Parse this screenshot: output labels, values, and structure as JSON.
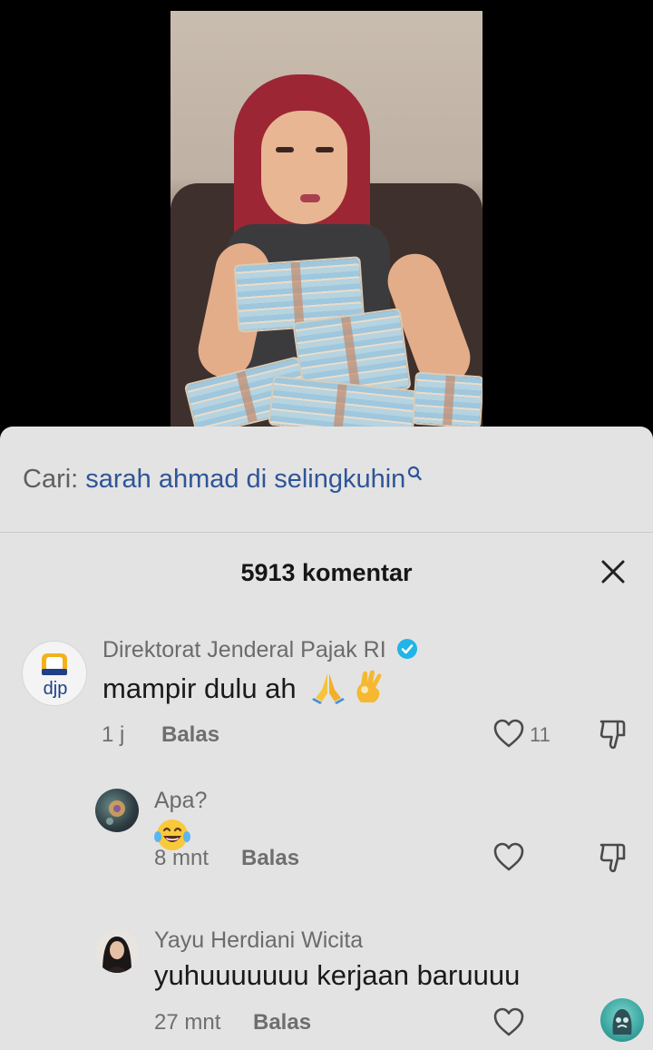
{
  "search": {
    "prefix": "Cari:",
    "query": "sarah ahmad di selingkuhin"
  },
  "comments_header": {
    "count_label": "5913 komentar"
  },
  "comments": [
    {
      "author": "Direktorat Jenderal Pajak RI",
      "verified": true,
      "avatar_text": "djp",
      "text": "mampir dulu ah",
      "emojis": [
        "folded-hands",
        "ok-hand"
      ],
      "time": "1 j",
      "reply_label": "Balas",
      "likes": "11"
    },
    {
      "author": "Apa?",
      "text_emoji": "face-with-tears-of-joy",
      "time": "8 mnt",
      "reply_label": "Balas"
    },
    {
      "author": "Yayu Herdiani Wicita",
      "text": "yuhuuuuuuu kerjaan baruuuu",
      "time": "27 mnt",
      "reply_label": "Balas"
    }
  ],
  "colors": {
    "sheet_bg": "#e3e3e3",
    "search_link": "#2e5597",
    "verified": "#20b5e6",
    "djp_blue": "#1f3f86",
    "djp_gold": "#f2b21c"
  }
}
